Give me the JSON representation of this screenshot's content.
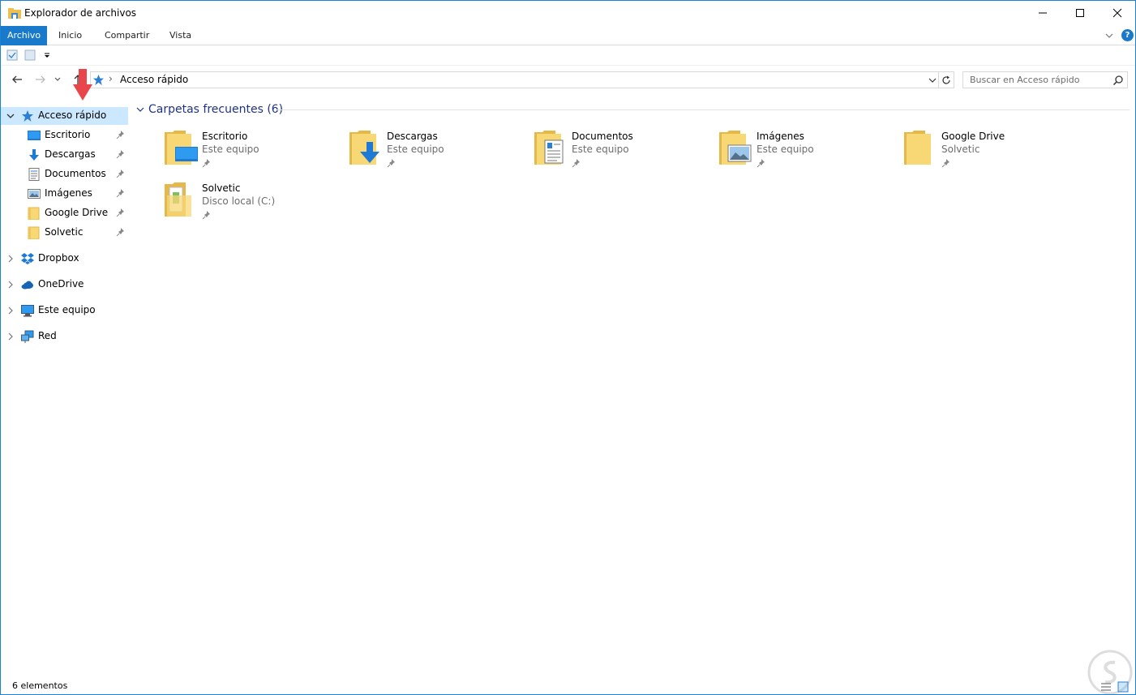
{
  "window": {
    "title": "Explorador de archivos"
  },
  "ribbon": {
    "tabs": [
      {
        "label": "Archivo",
        "active": true
      },
      {
        "label": "Inicio"
      },
      {
        "label": "Compartir"
      },
      {
        "label": "Vista"
      }
    ],
    "help_label": "?"
  },
  "address": {
    "path_separator": "›",
    "current": "Acceso rápido"
  },
  "search": {
    "placeholder": "Buscar en Acceso rápido"
  },
  "nav": {
    "quick_access": {
      "label": "Acceso rápido",
      "icon": "star-icon",
      "selected": true
    },
    "pinned": [
      {
        "label": "Escritorio",
        "icon": "desktop-folder-icon"
      },
      {
        "label": "Descargas",
        "icon": "downloads-icon"
      },
      {
        "label": "Documentos",
        "icon": "documents-icon"
      },
      {
        "label": "Imágenes",
        "icon": "pictures-icon"
      },
      {
        "label": "Google Drive",
        "icon": "folder-icon"
      },
      {
        "label": "Solvetic",
        "icon": "folder-icon"
      }
    ],
    "roots": [
      {
        "label": "Dropbox",
        "icon": "dropbox-icon"
      },
      {
        "label": "OneDrive",
        "icon": "cloud-icon"
      },
      {
        "label": "Este equipo",
        "icon": "computer-icon"
      },
      {
        "label": "Red",
        "icon": "network-icon"
      }
    ]
  },
  "content": {
    "group_title": "Carpetas frecuentes (6)",
    "folders": [
      {
        "name": "Escritorio",
        "location": "Este equipo",
        "icon": "desktop-folder-icon"
      },
      {
        "name": "Descargas",
        "location": "Este equipo",
        "icon": "downloads-folder-icon"
      },
      {
        "name": "Documentos",
        "location": "Este equipo",
        "icon": "documents-folder-icon"
      },
      {
        "name": "Imágenes",
        "location": "Este equipo",
        "icon": "pictures-folder-icon"
      },
      {
        "name": "Google Drive",
        "location": "Solvetic",
        "icon": "folder-icon"
      },
      {
        "name": "Solvetic",
        "location": "Disco local (C:)",
        "icon": "folder-with-files-icon"
      }
    ]
  },
  "status": {
    "item_count": "6 elementos"
  },
  "colors": {
    "accent": "#1979ca",
    "selection": "#cce8ff",
    "group_title": "#1e3287",
    "folder_yellow": "#f8d775",
    "annotation_arrow": "#e8464b"
  }
}
